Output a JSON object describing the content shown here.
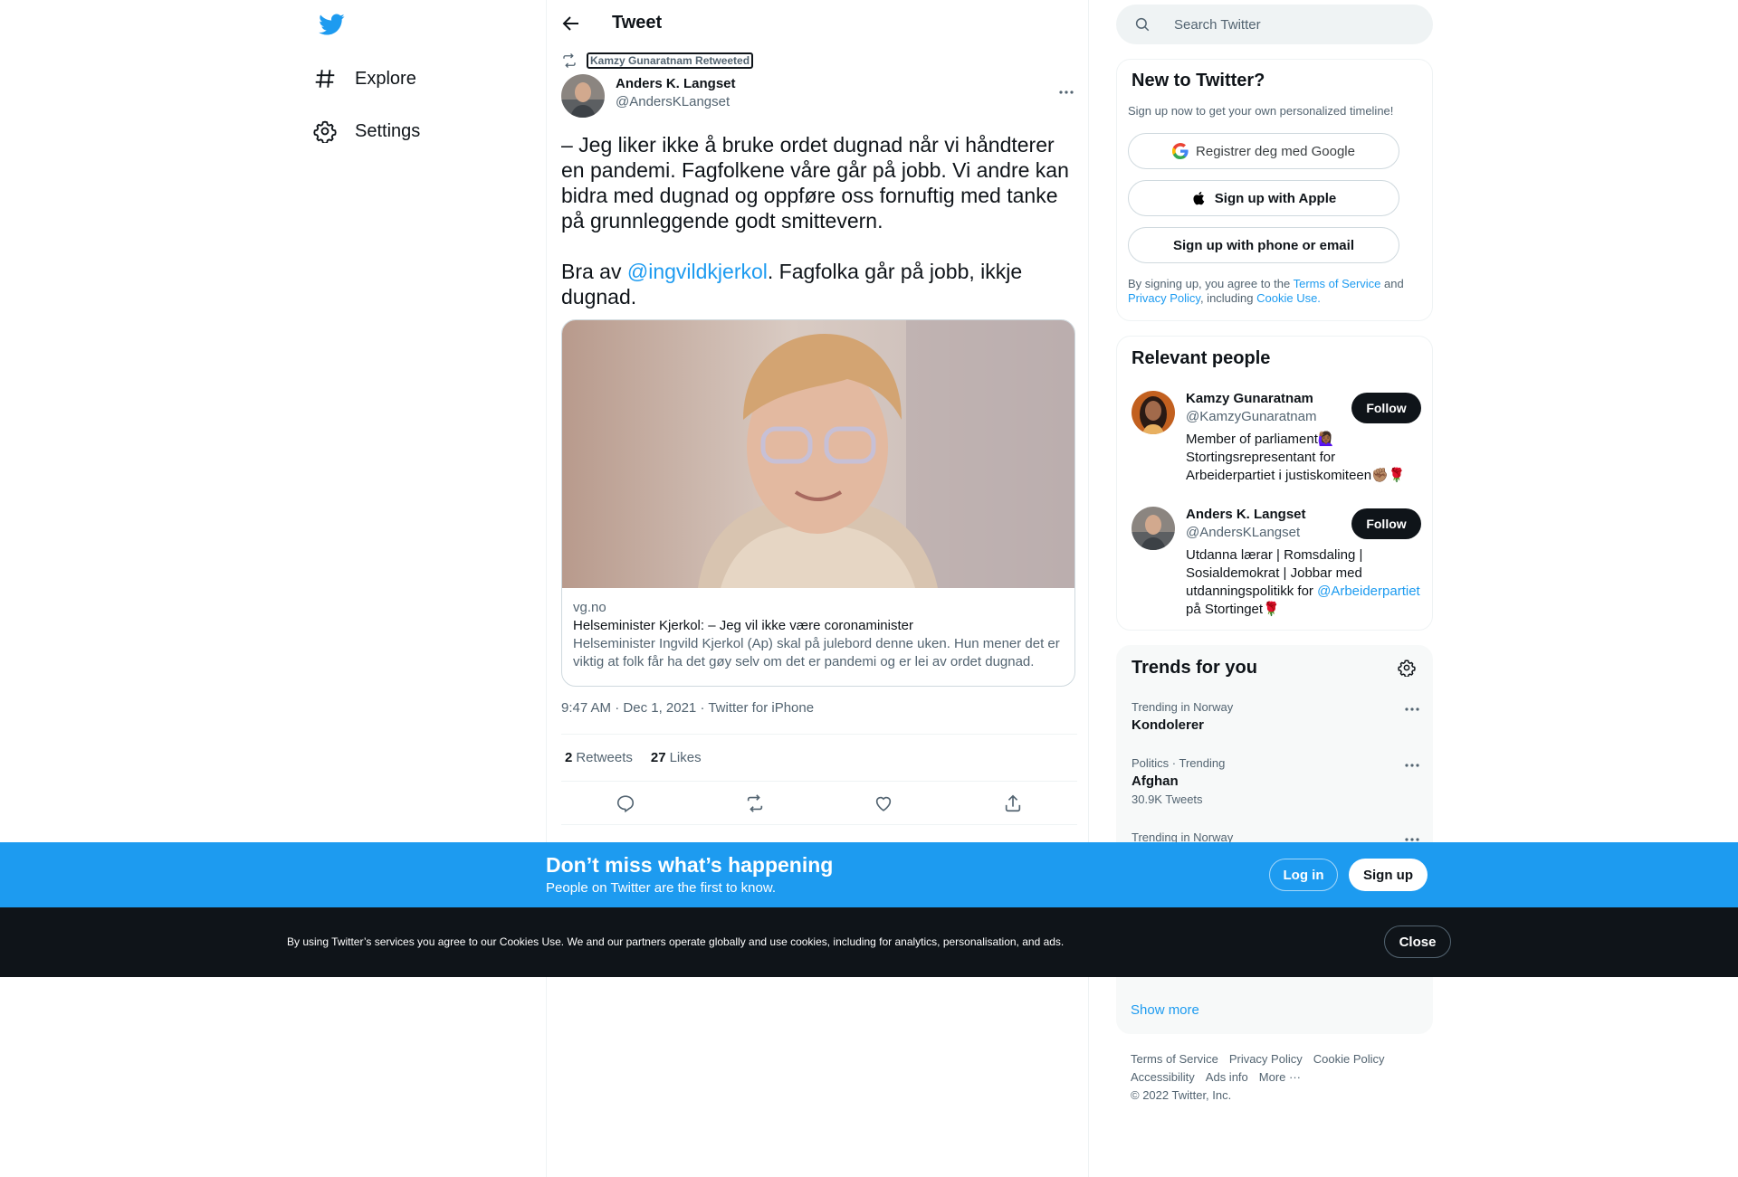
{
  "nav": {
    "items": [
      {
        "label": "Explore",
        "icon": "hashtag-icon"
      },
      {
        "label": "Settings",
        "icon": "gear-icon"
      }
    ]
  },
  "header": {
    "title": "Tweet"
  },
  "tweet": {
    "retweeted_by": "Kamzy Gunaratnam Retweeted",
    "author_name": "Anders K. Langset",
    "author_handle": "@AndersKLangset",
    "paragraph1": "– Jeg liker ikke å bruke ordet dugnad når vi håndterer en pandemi. Fagfolkene våre går på jobb. Vi andre kan bidra med dugnad og oppføre oss fornuftig med tanke på grunnleggende godt smittevern.",
    "paragraph2_before": "Bra av ",
    "paragraph2_mention": "@ingvildkjerkol",
    "paragraph2_after": ". Fagfolka går på jobb, ikkje dugnad.",
    "card": {
      "domain": "vg.no",
      "title": "Helseminister Kjerkol: – Jeg vil ikke være coronaminister",
      "description": "Helseminister Ingvild Kjerkol (Ap) skal på julebord denne uken. Hun mener det er viktig at folk får ha det gøy selv om det er pandemi og er lei av ordet dugnad."
    },
    "time": "9:47 AM",
    "date": "Dec 1, 2021",
    "source": "Twitter for iPhone",
    "retweets_count": "2",
    "retweets_label": "Retweets",
    "likes_count": "27",
    "likes_label": "Likes"
  },
  "search": {
    "placeholder": "Search Twitter"
  },
  "new_to_twitter": {
    "title": "New to Twitter?",
    "subtitle": "Sign up now to get your own personalized timeline!",
    "google": "Registrer deg med Google",
    "apple": "Sign up with Apple",
    "phone": "Sign up with phone or email",
    "legal_1": "By signing up, you agree to the ",
    "terms": "Terms of Service",
    "legal_2": " and ",
    "privacy": "Privacy Policy",
    "legal_3": ", including ",
    "cookie": "Cookie Use."
  },
  "relevant": {
    "title": "Relevant people",
    "people": [
      {
        "name": "Kamzy Gunaratnam",
        "handle": "@KamzyGunaratnam",
        "bio": "Member of parliament🙋🏾‍♀️ Stortingsrepresentant for Arbeiderpartiet i justiskomiteen✊🏽🌹",
        "follow": "Follow"
      },
      {
        "name": "Anders K. Langset",
        "handle": "@AndersKLangset",
        "bio_before": "Utdanna lærar | Romsdaling | Sosialdemokrat | Jobbar med utdanningspolitikk for ",
        "bio_mention": "@Arbeiderpartiet",
        "bio_after": " på Stortinget🌹",
        "follow": "Follow"
      }
    ]
  },
  "trends": {
    "title": "Trends for you",
    "items": [
      {
        "context": "Trending in Norway",
        "name": "Kondolerer",
        "count": ""
      },
      {
        "context": "Politics · Trending",
        "name": "Afghan",
        "count": "30.9K Tweets"
      },
      {
        "context": "Trending in Norway",
        "name": "",
        "count": ""
      }
    ],
    "show_more": "Show more"
  },
  "footer": {
    "links": [
      "Terms of Service",
      "Privacy Policy",
      "Cookie Policy",
      "Accessibility",
      "Ads info",
      "More ···"
    ],
    "copyright": "© 2022 Twitter, Inc."
  },
  "banner": {
    "title": "Don’t miss what’s happening",
    "subtitle": "People on Twitter are the first to know.",
    "login": "Log in",
    "signup": "Sign up"
  },
  "cookie_bar": {
    "text": "By using Twitter’s services you agree to our Cookies Use. We and our partners operate globally and use cookies, including for analytics, personalisation, and ads.",
    "close": "Close"
  },
  "colors": {
    "accent": "#1d9bf0",
    "text": "#0f1419",
    "secondary": "#536471"
  }
}
